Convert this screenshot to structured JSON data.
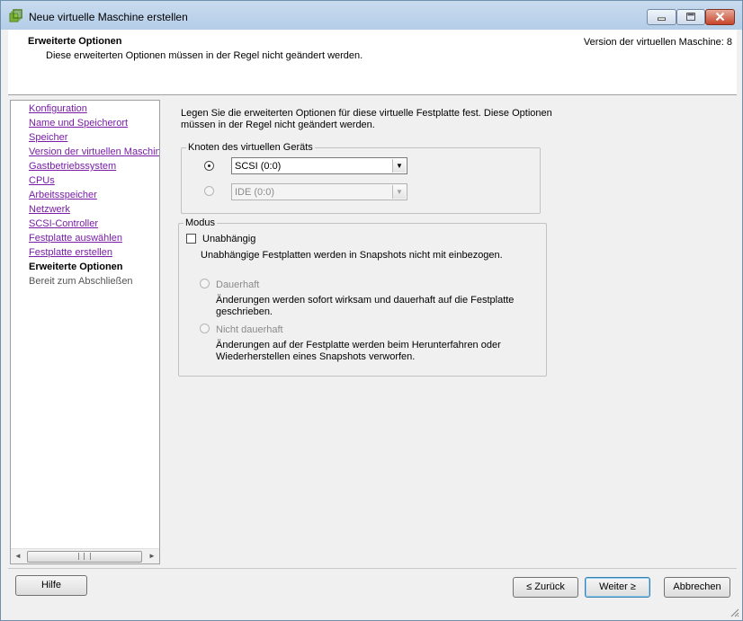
{
  "window": {
    "title": "Neue virtuelle Maschine erstellen",
    "title_icon": "vm-icon",
    "controls": [
      "minimize-icon",
      "maximize-icon",
      "close-icon"
    ]
  },
  "header": {
    "title": "Erweiterte Optionen",
    "subtitle": "Diese erweiterten Optionen müssen in der Regel nicht geändert werden.",
    "version": "Version der virtuellen Maschine: 8"
  },
  "nav": {
    "items": [
      {
        "label": "Konfiguration",
        "state": "link"
      },
      {
        "label": "Name und Speicherort",
        "state": "link"
      },
      {
        "label": "Speicher",
        "state": "link"
      },
      {
        "label": "Version der virtuellen Maschine",
        "state": "link"
      },
      {
        "label": "Gastbetriebssystem",
        "state": "link"
      },
      {
        "label": "CPUs",
        "state": "link"
      },
      {
        "label": "Arbeitsspeicher",
        "state": "link"
      },
      {
        "label": "Netzwerk",
        "state": "link"
      },
      {
        "label": "SCSI-Controller",
        "state": "link"
      },
      {
        "label": "Festplatte auswählen",
        "state": "link"
      },
      {
        "label": "Festplatte erstellen",
        "state": "link"
      },
      {
        "label": "Erweiterte Optionen",
        "state": "current"
      },
      {
        "label": "Bereit zum Abschließen",
        "state": "inactive"
      }
    ],
    "scrollbar": {
      "left_arrow": "◄",
      "right_arrow": "►"
    }
  },
  "main": {
    "intro": "Legen Sie die erweiterten Optionen für diese virtuelle Festplatte fest. Diese Optionen müssen in der Regel nicht geändert werden.",
    "knoten": {
      "legend": "Knoten des virtuellen Geräts",
      "scsi": {
        "value": "SCSI (0:0)",
        "selected": true,
        "enabled": true
      },
      "ide": {
        "value": "IDE (0:0)",
        "selected": false,
        "enabled": false
      }
    },
    "modus": {
      "legend": "Modus",
      "independent_label": "Unabhängig",
      "independent_checked": false,
      "independent_desc": "Unabhängige Festplatten werden in Snapshots nicht mit einbezogen.",
      "persistent_label": "Dauerhaft",
      "persistent_desc": "Änderungen werden sofort wirksam und dauerhaft auf die Festplatte geschrieben.",
      "nonpersistent_label": "Nicht dauerhaft",
      "nonpersistent_desc": "Änderungen auf der Festplatte werden beim Herunterfahren oder Wiederherstellen eines Snapshots verworfen."
    }
  },
  "footer": {
    "help": "Hilfe",
    "back": "≤ Zurück",
    "next": "Weiter ≥",
    "cancel": "Abbrechen"
  },
  "colors": {
    "link": "#7a1ca8",
    "titlebar": "#b4cde8",
    "close_button": "#c7452a"
  }
}
